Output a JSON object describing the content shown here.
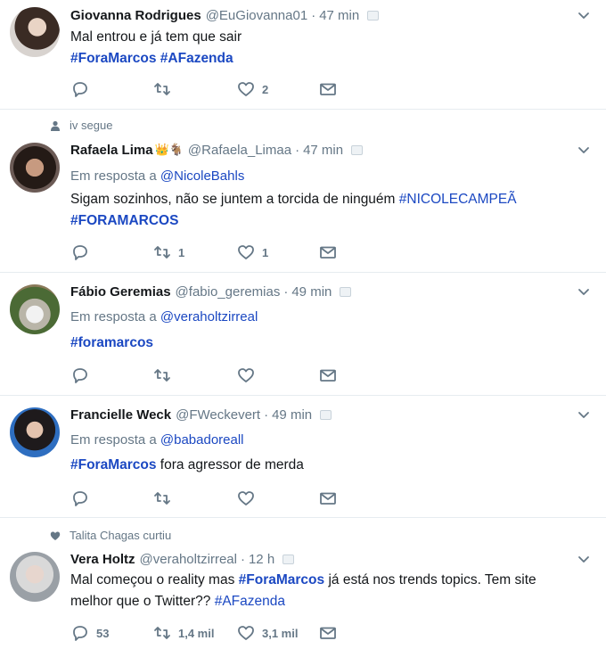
{
  "tweets": [
    {
      "context": "",
      "fullname": "Giovanna Rodrigues",
      "username": "@EuGiovanna01",
      "time": "47 min",
      "reply_to_prefix": "",
      "reply_to_user": "",
      "text_plain": "Mal entrou e já tem que sair",
      "hashtags_line": "#ForaMarcos #AFazenda",
      "reply_count": "",
      "retweet_count": "",
      "like_count": "2"
    },
    {
      "context": "iv segue",
      "fullname": "Rafaela Lima",
      "badge": "👑🐐",
      "username": "@Rafaela_Limaa",
      "time": "47 min",
      "reply_to_prefix": "Em resposta a",
      "reply_to_user": "@NicoleBahls",
      "text_plain": "Sigam sozinhos, não se juntem a torcida de ninguém",
      "hashtag_inline": "#NICOLECAMPEÃ",
      "hashtags_line": "#FORAMARCOS",
      "reply_count": "",
      "retweet_count": "1",
      "like_count": "1"
    },
    {
      "context": "",
      "fullname": "Fábio Geremias",
      "username": "@fabio_geremias",
      "time": "49 min",
      "reply_to_prefix": "Em resposta a",
      "reply_to_user": "@veraholtzirreal",
      "hashtags_line": "#foramarcos",
      "reply_count": "",
      "retweet_count": "",
      "like_count": ""
    },
    {
      "context": "",
      "fullname": "Francielle Weck",
      "username": "@FWeckevert",
      "time": "49 min",
      "reply_to_prefix": "Em resposta a",
      "reply_to_user": "@babadoreall",
      "hashtag_inline": "#ForaMarcos",
      "text_after": "fora agressor de merda",
      "reply_count": "",
      "retweet_count": "",
      "like_count": ""
    },
    {
      "context": "Talita Chagas curtiu",
      "fullname": "Vera Holtz",
      "username": "@veraholtzirreal",
      "time": "12 h",
      "text_before": "Mal começou o reality mas",
      "hashtag_inline": "#ForaMarcos",
      "text_after": "já está nos trends topics. Tem site melhor que o Twitter??",
      "hashtag_end": "#AFazenda",
      "reply_count": "53",
      "retweet_count": "1,4 mil",
      "like_count": "3,1 mil"
    }
  ],
  "colors": {
    "link": "#1b48c2",
    "muted": "#657786",
    "border": "#e6ecf0"
  },
  "icons": [
    "reply-icon",
    "retweet-icon",
    "like-icon",
    "direct-message-icon",
    "chevron-down-icon",
    "follow-person-icon",
    "heart-icon"
  ]
}
